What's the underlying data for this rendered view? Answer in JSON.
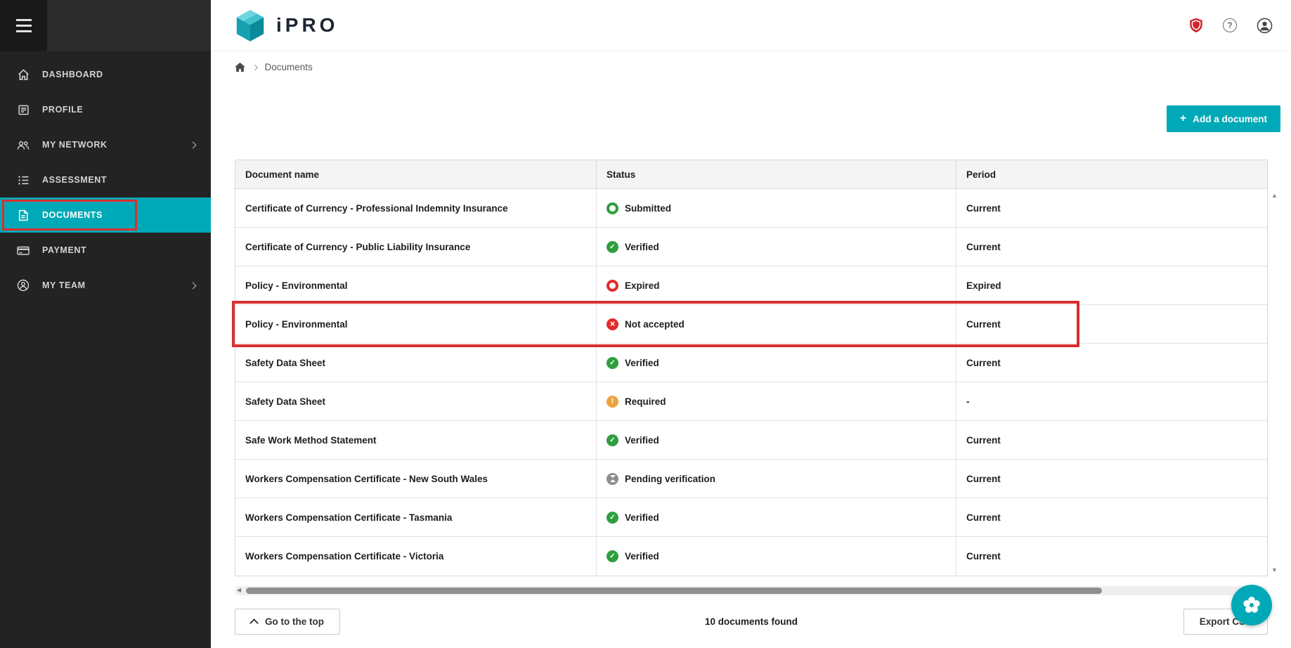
{
  "colors": {
    "accent": "#00a9b7",
    "annotation_red": "#d93030",
    "sidebar_bg": "#232323",
    "status_green": "#2f9e3f",
    "status_red": "#df2b2b",
    "status_orange": "#f0a23c",
    "status_gray": "#8d8d8d"
  },
  "header": {
    "logo_text": "iPRO",
    "help_glyph": "?",
    "icons": [
      "shield-badge-icon",
      "help-icon",
      "account-icon"
    ]
  },
  "sidebar": {
    "items": [
      {
        "label": "DASHBOARD",
        "icon": "home-icon",
        "active": false,
        "has_chevron": false
      },
      {
        "label": "PROFILE",
        "icon": "profile-icon",
        "active": false,
        "has_chevron": false
      },
      {
        "label": "MY NETWORK",
        "icon": "network-icon",
        "active": false,
        "has_chevron": true
      },
      {
        "label": "ASSESSMENT",
        "icon": "assessment-icon",
        "active": false,
        "has_chevron": false
      },
      {
        "label": "DOCUMENTS",
        "icon": "documents-icon",
        "active": true,
        "has_chevron": false,
        "annotated": true
      },
      {
        "label": "PAYMENT",
        "icon": "payment-icon",
        "active": false,
        "has_chevron": false
      },
      {
        "label": "MY TEAM",
        "icon": "team-icon",
        "active": false,
        "has_chevron": true
      }
    ]
  },
  "breadcrumb": {
    "home_icon": "home-icon",
    "items": [
      "Documents"
    ]
  },
  "toolbar": {
    "add_document_label": "Add a document",
    "plus_glyph": "+"
  },
  "table": {
    "columns": [
      "Document name",
      "Status",
      "Period"
    ],
    "rows": [
      {
        "name": "Certificate of Currency - Professional Indemnity Insurance",
        "status": "Submitted",
        "status_type": "submitted",
        "period": "Current"
      },
      {
        "name": "Certificate of Currency - Public Liability Insurance",
        "status": "Verified",
        "status_type": "verified",
        "period": "Current"
      },
      {
        "name": "Policy - Environmental",
        "status": "Expired",
        "status_type": "expired",
        "period": "Expired"
      },
      {
        "name": "Policy - Environmental",
        "status": "Not accepted",
        "status_type": "not-accepted",
        "period": "Current",
        "annotated": true
      },
      {
        "name": "Safety Data Sheet",
        "status": "Verified",
        "status_type": "verified",
        "period": "Current"
      },
      {
        "name": "Safety Data Sheet",
        "status": "Required",
        "status_type": "required",
        "period": "-"
      },
      {
        "name": "Safe Work Method Statement",
        "status": "Verified",
        "status_type": "verified",
        "period": "Current"
      },
      {
        "name": "Workers Compensation Certificate - New South Wales",
        "status": "Pending verification",
        "status_type": "pending",
        "period": "Current"
      },
      {
        "name": "Workers Compensation Certificate - Tasmania",
        "status": "Verified",
        "status_type": "verified",
        "period": "Current"
      },
      {
        "name": "Workers Compensation Certificate - Victoria",
        "status": "Verified",
        "status_type": "verified",
        "period": "Current"
      }
    ]
  },
  "scrollbars": {
    "up_glyph": "▲",
    "down_glyph": "▼",
    "left_glyph": "◀"
  },
  "footer": {
    "go_to_top_label": "Go to the top",
    "documents_found_text": "10 documents found",
    "export_label": "Export CSV"
  }
}
